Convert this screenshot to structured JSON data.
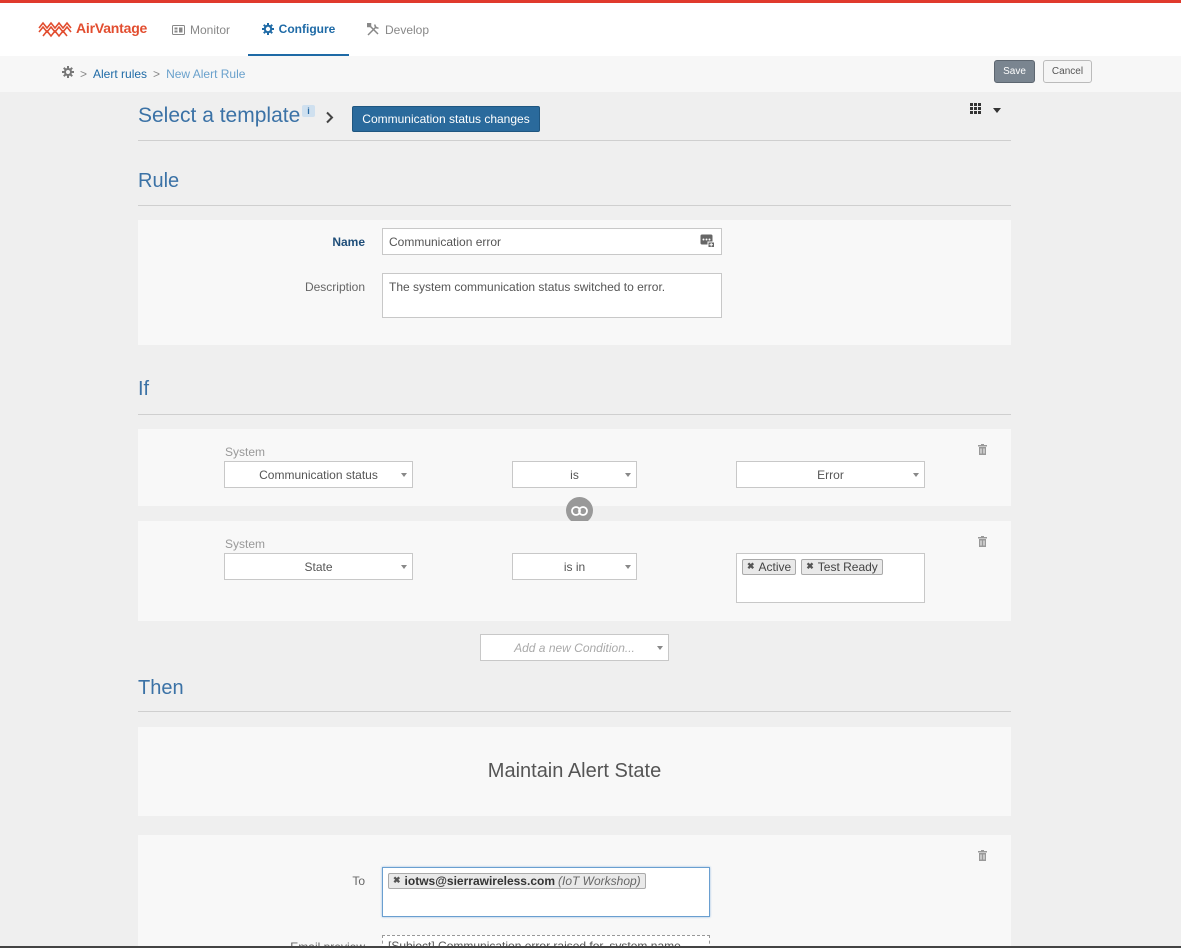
{
  "app": {
    "name": "AirVantage",
    "brand_color": "#e24d2f",
    "accent_color": "#1e6aa6"
  },
  "nav": {
    "items": [
      {
        "label": "Monitor",
        "icon": "dashboard-icon",
        "active": false
      },
      {
        "label": "Configure",
        "icon": "gear-icon",
        "active": true
      },
      {
        "label": "Develop",
        "icon": "tools-icon",
        "active": false
      }
    ]
  },
  "breadcrumb": {
    "separator": ">",
    "items": [
      "Alert rules",
      "New Alert Rule"
    ]
  },
  "actions": {
    "save_label": "Save",
    "cancel_label": "Cancel"
  },
  "template": {
    "title": "Select a template",
    "info_label": "i",
    "selected": "Communication status changes"
  },
  "rule": {
    "section_title": "Rule",
    "name_label": "Name",
    "name_value": "Communication error",
    "description_label": "Description",
    "description_value": "The system communication status switched to error."
  },
  "conditions": {
    "section_title": "If",
    "items": [
      {
        "category": "System",
        "field": "Communication status",
        "operator": "is",
        "value": "Error"
      },
      {
        "category": "System",
        "field": "State",
        "operator": "is in",
        "tags": [
          "Active",
          "Test Ready"
        ]
      }
    ],
    "add_placeholder": "Add a new Condition..."
  },
  "then": {
    "section_title": "Then",
    "maintain_label": "Maintain Alert State",
    "to_label": "To",
    "recipient_email": "iotws@sierrawireless.com",
    "recipient_org": "(IoT Workshop)",
    "preview_label": "Email preview",
    "preview_value": "[Subject] Communication error raised for, system name"
  }
}
